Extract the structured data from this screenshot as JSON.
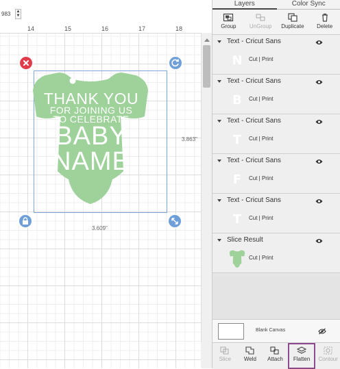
{
  "canvas": {
    "size_value": "983",
    "ruler_ticks": [
      "14",
      "15",
      "16",
      "17",
      "18"
    ],
    "design": {
      "line1": "THANK YOU",
      "line2": "FOR JOINING US",
      "line3": "TO CELEBRATE",
      "line4": "BABY",
      "line5": "NAME",
      "fill_color": "#9ed29a"
    },
    "height_dim": "3.863\"",
    "width_dim": "3.609\"",
    "delete_color": "#e03c4b",
    "handle_color": "#6f9fd9"
  },
  "panel": {
    "tabs": [
      {
        "label": "Layers",
        "active": true
      },
      {
        "label": "Color Sync",
        "active": false
      }
    ],
    "layer_tools": [
      {
        "label": "Group",
        "icon": "group-icon",
        "enabled": true
      },
      {
        "label": "UnGroup",
        "icon": "ungroup-icon",
        "enabled": false
      },
      {
        "label": "Duplicate",
        "icon": "duplicate-icon",
        "enabled": true
      },
      {
        "label": "Delete",
        "icon": "trash-icon",
        "enabled": true
      }
    ],
    "layers": [
      {
        "name": "Text - Cricut Sans",
        "glyph": "N",
        "ops": "Cut  |  Print"
      },
      {
        "name": "Text - Cricut Sans",
        "glyph": "B",
        "ops": "Cut  |  Print"
      },
      {
        "name": "Text - Cricut Sans",
        "glyph": "T",
        "ops": "Cut  |  Print"
      },
      {
        "name": "Text - Cricut Sans",
        "glyph": "F",
        "ops": "Cut  |  Print"
      },
      {
        "name": "Text - Cricut Sans",
        "glyph": "T",
        "ops": "Cut  |  Print"
      },
      {
        "name": "Slice Result",
        "glyph": "",
        "ops": "Cut  |  Print"
      }
    ],
    "blank_canvas": {
      "label": "Blank Canvas"
    },
    "bottom_tools": [
      {
        "label": "Slice",
        "icon": "slice-icon",
        "enabled": false
      },
      {
        "label": "Weld",
        "icon": "weld-icon",
        "enabled": true
      },
      {
        "label": "Attach",
        "icon": "attach-icon",
        "enabled": true
      },
      {
        "label": "Flatten",
        "icon": "flatten-icon",
        "enabled": true,
        "highlighted": true
      },
      {
        "label": "Contour",
        "icon": "contour-icon",
        "enabled": false
      }
    ],
    "highlight_color": "#8b4a8e"
  }
}
